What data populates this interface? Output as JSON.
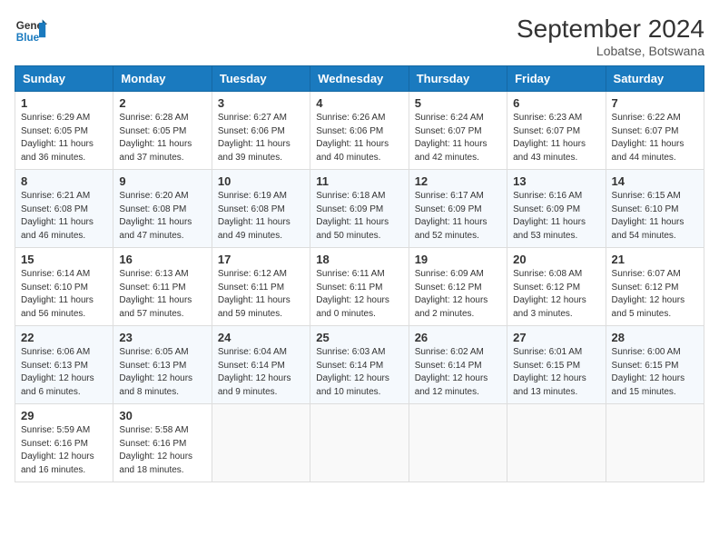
{
  "header": {
    "logo_line1": "General",
    "logo_line2": "Blue",
    "title": "September 2024",
    "subtitle": "Lobatse, Botswana"
  },
  "weekdays": [
    "Sunday",
    "Monday",
    "Tuesday",
    "Wednesday",
    "Thursday",
    "Friday",
    "Saturday"
  ],
  "weeks": [
    [
      {
        "day": "1",
        "sunrise": "6:29 AM",
        "sunset": "6:05 PM",
        "daylight": "11 hours and 36 minutes."
      },
      {
        "day": "2",
        "sunrise": "6:28 AM",
        "sunset": "6:05 PM",
        "daylight": "11 hours and 37 minutes."
      },
      {
        "day": "3",
        "sunrise": "6:27 AM",
        "sunset": "6:06 PM",
        "daylight": "11 hours and 39 minutes."
      },
      {
        "day": "4",
        "sunrise": "6:26 AM",
        "sunset": "6:06 PM",
        "daylight": "11 hours and 40 minutes."
      },
      {
        "day": "5",
        "sunrise": "6:24 AM",
        "sunset": "6:07 PM",
        "daylight": "11 hours and 42 minutes."
      },
      {
        "day": "6",
        "sunrise": "6:23 AM",
        "sunset": "6:07 PM",
        "daylight": "11 hours and 43 minutes."
      },
      {
        "day": "7",
        "sunrise": "6:22 AM",
        "sunset": "6:07 PM",
        "daylight": "11 hours and 44 minutes."
      }
    ],
    [
      {
        "day": "8",
        "sunrise": "6:21 AM",
        "sunset": "6:08 PM",
        "daylight": "11 hours and 46 minutes."
      },
      {
        "day": "9",
        "sunrise": "6:20 AM",
        "sunset": "6:08 PM",
        "daylight": "11 hours and 47 minutes."
      },
      {
        "day": "10",
        "sunrise": "6:19 AM",
        "sunset": "6:08 PM",
        "daylight": "11 hours and 49 minutes."
      },
      {
        "day": "11",
        "sunrise": "6:18 AM",
        "sunset": "6:09 PM",
        "daylight": "11 hours and 50 minutes."
      },
      {
        "day": "12",
        "sunrise": "6:17 AM",
        "sunset": "6:09 PM",
        "daylight": "11 hours and 52 minutes."
      },
      {
        "day": "13",
        "sunrise": "6:16 AM",
        "sunset": "6:09 PM",
        "daylight": "11 hours and 53 minutes."
      },
      {
        "day": "14",
        "sunrise": "6:15 AM",
        "sunset": "6:10 PM",
        "daylight": "11 hours and 54 minutes."
      }
    ],
    [
      {
        "day": "15",
        "sunrise": "6:14 AM",
        "sunset": "6:10 PM",
        "daylight": "11 hours and 56 minutes."
      },
      {
        "day": "16",
        "sunrise": "6:13 AM",
        "sunset": "6:11 PM",
        "daylight": "11 hours and 57 minutes."
      },
      {
        "day": "17",
        "sunrise": "6:12 AM",
        "sunset": "6:11 PM",
        "daylight": "11 hours and 59 minutes."
      },
      {
        "day": "18",
        "sunrise": "6:11 AM",
        "sunset": "6:11 PM",
        "daylight": "12 hours and 0 minutes."
      },
      {
        "day": "19",
        "sunrise": "6:09 AM",
        "sunset": "6:12 PM",
        "daylight": "12 hours and 2 minutes."
      },
      {
        "day": "20",
        "sunrise": "6:08 AM",
        "sunset": "6:12 PM",
        "daylight": "12 hours and 3 minutes."
      },
      {
        "day": "21",
        "sunrise": "6:07 AM",
        "sunset": "6:12 PM",
        "daylight": "12 hours and 5 minutes."
      }
    ],
    [
      {
        "day": "22",
        "sunrise": "6:06 AM",
        "sunset": "6:13 PM",
        "daylight": "12 hours and 6 minutes."
      },
      {
        "day": "23",
        "sunrise": "6:05 AM",
        "sunset": "6:13 PM",
        "daylight": "12 hours and 8 minutes."
      },
      {
        "day": "24",
        "sunrise": "6:04 AM",
        "sunset": "6:14 PM",
        "daylight": "12 hours and 9 minutes."
      },
      {
        "day": "25",
        "sunrise": "6:03 AM",
        "sunset": "6:14 PM",
        "daylight": "12 hours and 10 minutes."
      },
      {
        "day": "26",
        "sunrise": "6:02 AM",
        "sunset": "6:14 PM",
        "daylight": "12 hours and 12 minutes."
      },
      {
        "day": "27",
        "sunrise": "6:01 AM",
        "sunset": "6:15 PM",
        "daylight": "12 hours and 13 minutes."
      },
      {
        "day": "28",
        "sunrise": "6:00 AM",
        "sunset": "6:15 PM",
        "daylight": "12 hours and 15 minutes."
      }
    ],
    [
      {
        "day": "29",
        "sunrise": "5:59 AM",
        "sunset": "6:16 PM",
        "daylight": "12 hours and 16 minutes."
      },
      {
        "day": "30",
        "sunrise": "5:58 AM",
        "sunset": "6:16 PM",
        "daylight": "12 hours and 18 minutes."
      },
      null,
      null,
      null,
      null,
      null
    ]
  ]
}
